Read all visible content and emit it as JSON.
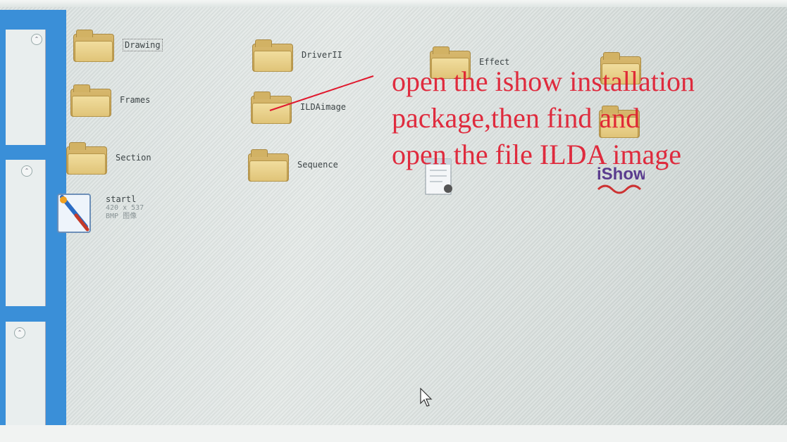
{
  "folders": [
    {
      "name": "Drawing"
    },
    {
      "name": "DriverII"
    },
    {
      "name": "Effect"
    },
    {
      "name": "Frames"
    },
    {
      "name": "ILDAimage"
    },
    {
      "name": "Section"
    },
    {
      "name": "Sequence"
    }
  ],
  "files": {
    "startl": {
      "name": "startl",
      "dimensions": "420 x 537",
      "type": "BMP 图像"
    },
    "ishow": {
      "logo_text": "iShow"
    }
  },
  "annotation": {
    "line1": "open the ishow installation",
    "line2": "package,then find and",
    "line3": "open the file ILDA image"
  },
  "colors": {
    "annotation": "#e0182d",
    "nav_pane": "#3a8fd8"
  }
}
